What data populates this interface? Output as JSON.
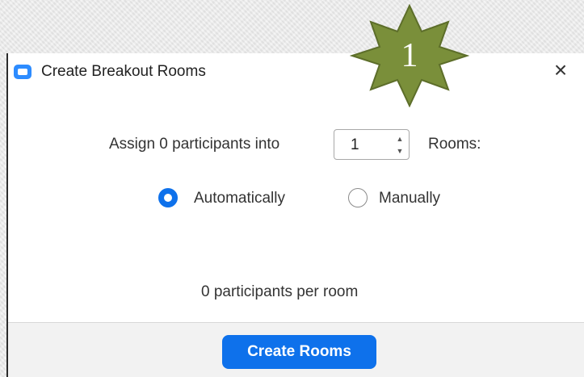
{
  "dialog": {
    "title": "Create Breakout Rooms",
    "close_label": "×",
    "app_icon": "zoom-camera-icon"
  },
  "assign": {
    "prefix": "Assign 0 participants into",
    "rooms_value": "1",
    "suffix": "Rooms:"
  },
  "assignment_mode": {
    "options": [
      {
        "label": "Automatically",
        "selected": true
      },
      {
        "label": "Manually",
        "selected": false
      }
    ]
  },
  "per_room_text": "0 participants per room",
  "footer": {
    "create_label": "Create Rooms"
  },
  "annotation": {
    "badge_number": "1",
    "badge_color": "#7a8f3a"
  },
  "colors": {
    "accent": "#0e71eb",
    "app_icon": "#2d8cff"
  }
}
